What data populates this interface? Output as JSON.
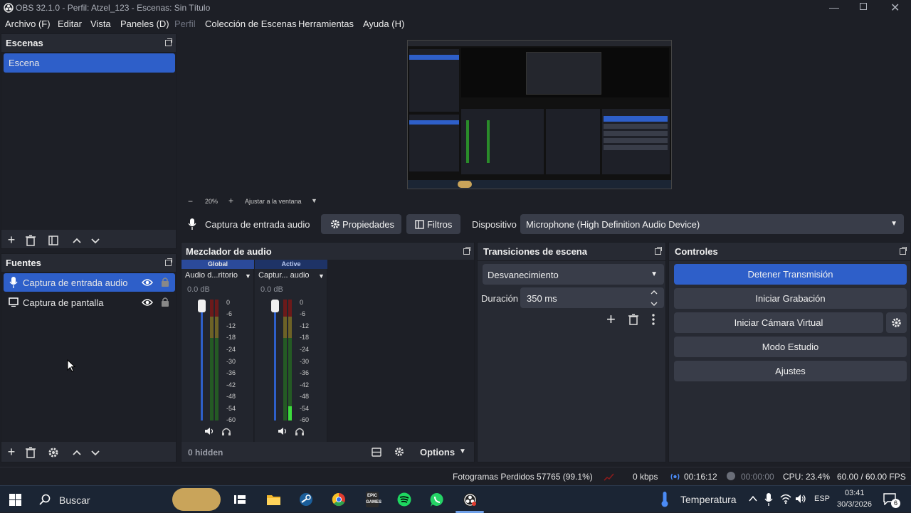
{
  "window": {
    "title": "OBS 32.1.0 - Perfil: Atzel_123 - Escenas: Sin Título"
  },
  "menu": [
    "Archivo (F)",
    "Editar",
    "Vista",
    "Paneles (D)",
    "Perfil",
    "Colección de Escenas",
    "Herramientas",
    "Ayuda (H)"
  ],
  "scenes": {
    "title": "Escenas",
    "items": [
      "Escena"
    ]
  },
  "sources": {
    "title": "Fuentes",
    "items": [
      {
        "label": "Captura de entrada audio"
      },
      {
        "label": "Captura de pantalla"
      }
    ]
  },
  "preview": {
    "zoom": "20%",
    "fit": "Ajustar a la ventana"
  },
  "context_bar": {
    "source": "Captura de entrada audio",
    "properties": "Propiedades",
    "filters": "Filtros",
    "device_label": "Dispositivo",
    "device_value": "Microphone (High Definition Audio Device)"
  },
  "mixer": {
    "title": "Mezclador de audio",
    "channels": [
      {
        "badge": "Global",
        "name": "Audio d...ritorio",
        "db": "0.0 dB",
        "level": 0.0
      },
      {
        "badge": "Active",
        "name": "Captur... audio",
        "db": "0.0 dB",
        "level": 0.12
      }
    ],
    "scale": [
      "0",
      "-6",
      "-12",
      "-18",
      "-24",
      "-30",
      "-36",
      "-42",
      "-48",
      "-54",
      "-60"
    ],
    "hidden": "0 hidden",
    "options": "Options"
  },
  "transitions": {
    "title": "Transiciones de escena",
    "selected": "Desvanecimiento",
    "duration_label": "Duración",
    "duration_value": "350 ms"
  },
  "controls": {
    "title": "Controles",
    "stream": "Detener Transmisión",
    "record": "Iniciar Grabación",
    "virtualcam": "Iniciar Cámara Virtual",
    "studio": "Modo Estudio",
    "settings": "Ajustes"
  },
  "status": {
    "dropped": "Fotogramas Perdidos 57765 (99.1%)",
    "bitrate": "0 kbps",
    "stream_time": "00:16:12",
    "rec_time": "00:00:00",
    "cpu": "CPU: 23.4%",
    "fps": "60.00 / 60.00 FPS"
  },
  "taskbar": {
    "search": "Buscar",
    "weather": "Temperatura",
    "lang": "ESP",
    "time": "03:41",
    "date": "30/3/2026",
    "notif_count": "6"
  },
  "colors": {
    "accent": "#2e5fc9",
    "panel": "#272a33",
    "bg": "#1d1f26",
    "button": "#393d49"
  }
}
